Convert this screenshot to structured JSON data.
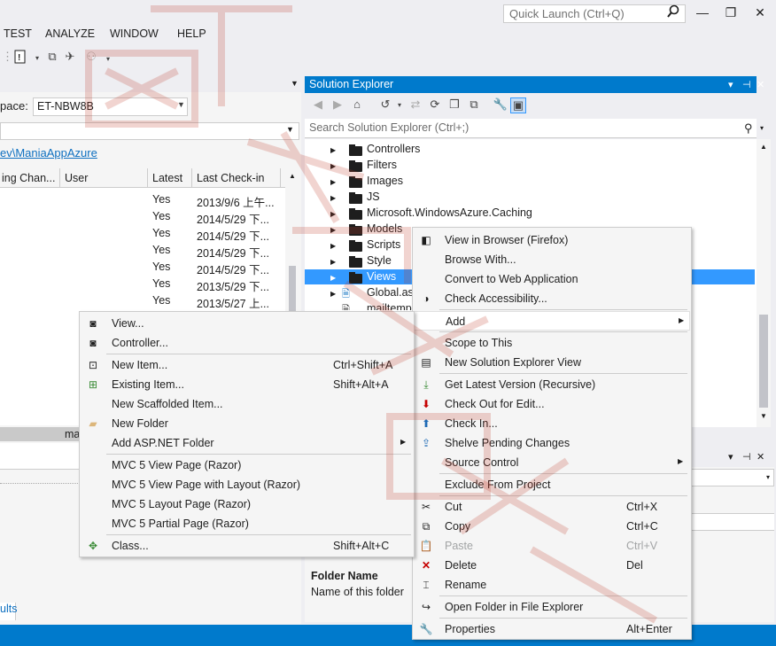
{
  "quick_launch": {
    "placeholder": "Quick Launch (Ctrl+Q)"
  },
  "window_buttons": {
    "minimize": "—",
    "restore": "❐",
    "close": "✕"
  },
  "menu": [
    "TEST",
    "ANALYZE",
    "WINDOW",
    "HELP"
  ],
  "source_control": {
    "workspace_label": "pace:",
    "workspace_value": "ET-NBW8B",
    "path_link": "ev\\ManiaAppAzure",
    "columns": [
      "ing Chan...",
      "User",
      "Latest",
      "Last Check-in"
    ],
    "rows": [
      {
        "latest": "Yes",
        "checkin": "2013/9/6 上午..."
      },
      {
        "latest": "Yes",
        "checkin": "2014/5/29 下..."
      },
      {
        "latest": "Yes",
        "checkin": "2014/5/29 下..."
      },
      {
        "latest": "Yes",
        "checkin": "2014/5/29 下..."
      },
      {
        "latest": "Yes",
        "checkin": "2014/5/29 下..."
      },
      {
        "latest": "Yes",
        "checkin": "2013/5/29 下..."
      },
      {
        "latest": "Yes",
        "checkin": "2013/5/27 上..."
      }
    ],
    "selected_row_text": "ma",
    "tab_results": "ults"
  },
  "solution_explorer": {
    "title": "Solution Explorer",
    "title_buttons": [
      "▾",
      "⊣",
      "✕"
    ],
    "search_placeholder": "Search Solution Explorer (Ctrl+;)",
    "items": [
      {
        "label": "Controllers"
      },
      {
        "label": "Filters"
      },
      {
        "label": "Images"
      },
      {
        "label": "JS"
      },
      {
        "label": "Microsoft.WindowsAzure.Caching"
      },
      {
        "label": "Models"
      },
      {
        "label": "Scripts"
      },
      {
        "label": "Style"
      },
      {
        "label": "Views"
      },
      {
        "label": "Global.as"
      },
      {
        "label": "mailtemp"
      }
    ]
  },
  "properties": {
    "title_buttons": [
      "▾",
      "⊣",
      "✕"
    ],
    "prop_name": "Folder Name",
    "prop_desc": "Name of this folder"
  },
  "context_menu": {
    "items": [
      {
        "label": "View in Browser (Firefox)",
        "shortcut": "",
        "icon": "browser-icon"
      },
      {
        "label": "Browse With...",
        "shortcut": ""
      },
      {
        "label": "Convert to Web Application",
        "shortcut": ""
      },
      {
        "label": "Check Accessibility...",
        "shortcut": "",
        "icon": "accessibility-icon"
      },
      {
        "label": "Add",
        "shortcut": ""
      },
      {
        "label": "Scope to This",
        "shortcut": ""
      },
      {
        "label": "New Solution Explorer View",
        "shortcut": "",
        "icon": "new-view-icon"
      },
      {
        "label": "Get Latest Version (Recursive)",
        "shortcut": "",
        "icon": "get-latest-icon"
      },
      {
        "label": "Check Out for Edit...",
        "shortcut": "",
        "icon": "check-out-icon"
      },
      {
        "label": "Check In...",
        "shortcut": "",
        "icon": "check-in-icon"
      },
      {
        "label": "Shelve Pending Changes",
        "shortcut": "",
        "icon": "shelve-icon"
      },
      {
        "label": "Source Control",
        "shortcut": ""
      },
      {
        "label": "Exclude From Project",
        "shortcut": ""
      },
      {
        "label": "Cut",
        "shortcut": "Ctrl+X",
        "icon": "cut-icon"
      },
      {
        "label": "Copy",
        "shortcut": "Ctrl+C",
        "icon": "copy-icon"
      },
      {
        "label": "Paste",
        "shortcut": "Ctrl+V",
        "icon": "paste-icon",
        "disabled": true
      },
      {
        "label": "Delete",
        "shortcut": "Del",
        "icon": "delete-icon"
      },
      {
        "label": "Rename",
        "shortcut": "",
        "icon": "rename-icon"
      },
      {
        "label": "Open Folder in File Explorer",
        "shortcut": "",
        "icon": "open-folder-icon"
      },
      {
        "label": "Properties",
        "shortcut": "Alt+Enter",
        "icon": "properties-icon"
      }
    ]
  },
  "add_submenu": {
    "items": [
      {
        "label": "View...",
        "shortcut": ""
      },
      {
        "label": "Controller...",
        "shortcut": ""
      },
      {
        "label": "New Item...",
        "shortcut": "Ctrl+Shift+A"
      },
      {
        "label": "Existing Item...",
        "shortcut": "Shift+Alt+A"
      },
      {
        "label": "New Scaffolded Item...",
        "shortcut": ""
      },
      {
        "label": "New Folder",
        "shortcut": ""
      },
      {
        "label": "Add ASP.NET Folder",
        "shortcut": ""
      },
      {
        "label": "MVC 5 View Page (Razor)",
        "shortcut": ""
      },
      {
        "label": "MVC 5 View Page with Layout (Razor)",
        "shortcut": ""
      },
      {
        "label": "MVC 5 Layout Page (Razor)",
        "shortcut": ""
      },
      {
        "label": "MVC 5 Partial Page (Razor)",
        "shortcut": ""
      },
      {
        "label": "Class...",
        "shortcut": "Shift+Alt+C"
      }
    ]
  },
  "watermark": "Lettering watermark"
}
